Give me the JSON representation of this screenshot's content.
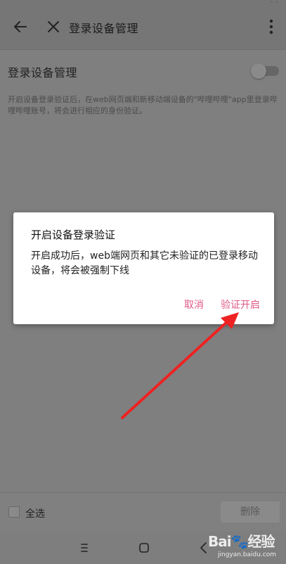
{
  "header": {
    "title": "登录设备管理",
    "status_dots": "• •",
    "icons": {
      "back": "back-arrow-icon",
      "close": "close-icon",
      "more": "more-vertical-icon"
    }
  },
  "setting": {
    "title": "登录设备管理",
    "toggle_on": false,
    "description": "开启设备登录验证后，在web网页端和新移动端设备的\"哔哩哔哩\"app里登录哔哩哔哩账号，将会进行相应的身份验证。"
  },
  "dialog": {
    "title": "开启设备登录验证",
    "message": "开启成功后，web端网页和其它未验证的已登录移动设备，将会被强制下线",
    "cancel_label": "取消",
    "confirm_label": "验证开启"
  },
  "bottom": {
    "select_all_label": "全选",
    "delete_label": "删除"
  },
  "navbar": {
    "icons": [
      "menu-lines-icon",
      "home-square-icon",
      "back-chevron-icon"
    ]
  },
  "watermark": {
    "logo_text": "Bai",
    "logo_text_2": "经验",
    "sub_text": "jingyan.baidu.com"
  },
  "colors": {
    "accent": "#e05a86",
    "overlay": "#7f7f7f",
    "arrow": "#ee2222"
  }
}
